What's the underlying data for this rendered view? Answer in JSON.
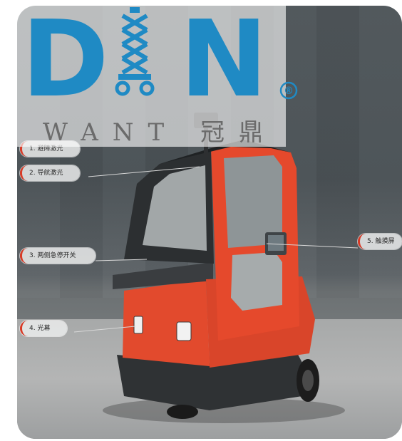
{
  "brand": {
    "logo_main": "D N",
    "logo_letter_left": "D",
    "logo_letter_right": "N",
    "logo_sub": "WANT 冠鼎",
    "registered_mark": "®",
    "colors": {
      "logo_blue": "#1f8ac4",
      "logo_gray": "#6b6b6b",
      "vehicle_orange": "#e8452b",
      "label_accent": "#d93a26"
    }
  },
  "callouts": [
    {
      "label": "1. 避障激光"
    },
    {
      "label": "2. 导航激光"
    },
    {
      "label": "3. 两侧急停开关"
    },
    {
      "label": "4. 光幕"
    },
    {
      "label": "5. 触摸屏"
    }
  ]
}
